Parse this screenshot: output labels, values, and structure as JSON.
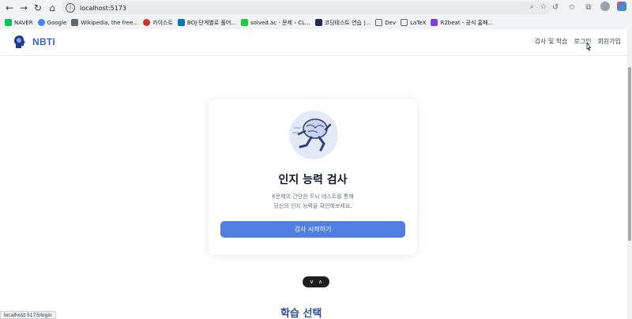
{
  "browser": {
    "url": "localhost:5173",
    "status_url": "localhost:5173/login",
    "bookmarks": [
      {
        "label": "NAVER",
        "color": "#03c75a"
      },
      {
        "label": "Google",
        "color": "#4285f4"
      },
      {
        "label": "Wikipedia, the free...",
        "color": "#666666"
      },
      {
        "label": "카이스트",
        "color": "#d93025"
      },
      {
        "label": "BOJ-단계별로 풀어...",
        "color": "#0076c0"
      },
      {
        "label": "solved.ac - 문제 › CL...",
        "color": "#17ce3a"
      },
      {
        "label": "코딩테스트 연습 |...",
        "color": "#1e2a5a"
      },
      {
        "label": "Dev",
        "color": "#5f6368"
      },
      {
        "label": "LaTeX",
        "color": "#5f6368"
      },
      {
        "label": "R2beat - 공식 홈페...",
        "color": "#7b3fe4"
      }
    ]
  },
  "header": {
    "brand": "NBTI",
    "nav": {
      "test_study": "검사 및 학습",
      "login": "로그인",
      "signup": "회원가입"
    }
  },
  "card": {
    "title": "인지 능력 검사",
    "desc_line1": "6문제의 간단한 두뇌 테스트를 통해",
    "desc_line2": "당신의 인지 능력을 확인해보세요.",
    "start_button": "검사 시작하기"
  },
  "section": {
    "title": "학습 선택"
  },
  "colors": {
    "accent": "#4f7fe0",
    "brand": "#3b64c5",
    "section_title": "#2b4c9a"
  }
}
